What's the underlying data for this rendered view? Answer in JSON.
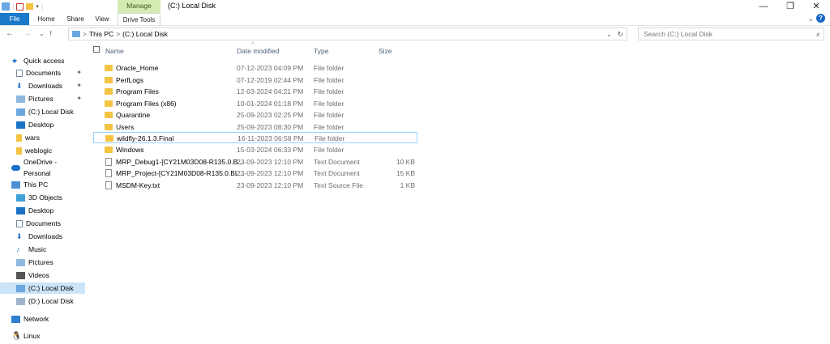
{
  "title_bar": {
    "manage_tab": "Manage",
    "window_title": "(C:) Local Disk",
    "minimize": "—",
    "maximize": "❐",
    "close": "✕"
  },
  "ribbon": {
    "tabs": [
      "File",
      "Home",
      "Share",
      "View",
      "Drive Tools"
    ],
    "help": "?"
  },
  "address": {
    "back": "←",
    "forward": "→",
    "recent": "⌄",
    "up": "↑",
    "crumbs": [
      "This PC",
      "(C:) Local Disk"
    ],
    "separator": ">",
    "dropdown": "⌄",
    "refresh": "↻",
    "search_placeholder": "Search (C:) Local Disk"
  },
  "sidebar": {
    "items": [
      {
        "label": "Quick access",
        "icon": "star-icon",
        "pinned": false
      },
      {
        "label": "Documents",
        "icon": "documents-icon",
        "pinned": true
      },
      {
        "label": "Downloads",
        "icon": "downloads-icon",
        "pinned": true
      },
      {
        "label": "Pictures",
        "icon": "pictures-icon",
        "pinned": true
      },
      {
        "label": "(C:) Local Disk",
        "icon": "drive-icon",
        "pinned": false
      },
      {
        "label": "Desktop",
        "icon": "desktop-icon",
        "pinned": false
      },
      {
        "label": "wars",
        "icon": "folder-icon",
        "pinned": false
      },
      {
        "label": "weblogic",
        "icon": "folder-icon",
        "pinned": false
      },
      {
        "label": "OneDrive - Personal",
        "icon": "cloud-icon",
        "pinned": false
      },
      {
        "label": "This PC",
        "icon": "computer-icon",
        "pinned": false
      },
      {
        "label": "3D Objects",
        "icon": "3d-objects-icon",
        "pinned": false
      },
      {
        "label": "Desktop",
        "icon": "desktop-icon",
        "pinned": false
      },
      {
        "label": "Documents",
        "icon": "documents-icon",
        "pinned": false
      },
      {
        "label": "Downloads",
        "icon": "downloads-icon",
        "pinned": false
      },
      {
        "label": "Music",
        "icon": "music-icon",
        "pinned": false
      },
      {
        "label": "Pictures",
        "icon": "pictures-icon",
        "pinned": false
      },
      {
        "label": "Videos",
        "icon": "videos-icon",
        "pinned": false
      },
      {
        "label": "(C:) Local Disk",
        "icon": "drive-icon",
        "pinned": false,
        "selected": true
      },
      {
        "label": "(D:) Local Disk",
        "icon": "drive-icon",
        "pinned": false
      },
      {
        "label": "Network",
        "icon": "network-icon",
        "pinned": false
      },
      {
        "label": "Linux",
        "icon": "linux-icon",
        "pinned": false
      }
    ],
    "pin_glyph": "📌"
  },
  "columns": {
    "name": "Name",
    "date": "Date modified",
    "type": "Type",
    "size": "Size",
    "sort_caret": "^"
  },
  "files": [
    {
      "name": "Oracle_Home",
      "date": "07-12-2023 04:09 PM",
      "type": "File folder",
      "size": "",
      "kind": "folder"
    },
    {
      "name": "PerfLogs",
      "date": "07-12-2019 02:44 PM",
      "type": "File folder",
      "size": "",
      "kind": "folder"
    },
    {
      "name": "Program Files",
      "date": "12-03-2024 04:21 PM",
      "type": "File folder",
      "size": "",
      "kind": "folder"
    },
    {
      "name": "Program Files (x86)",
      "date": "10-01-2024 01:18 PM",
      "type": "File folder",
      "size": "",
      "kind": "folder"
    },
    {
      "name": "Quarantine",
      "date": "25-09-2023 02:25 PM",
      "type": "File folder",
      "size": "",
      "kind": "folder"
    },
    {
      "name": "Users",
      "date": "25-09-2023 08:30 PM",
      "type": "File folder",
      "size": "",
      "kind": "folder"
    },
    {
      "name": "wildfly-26.1.3.Final",
      "date": "16-11-2023 06:58 PM",
      "type": "File folder",
      "size": "",
      "kind": "folder",
      "focused": true
    },
    {
      "name": "Windows",
      "date": "15-03-2024 06:33 PM",
      "type": "File folder",
      "size": "",
      "kind": "folder"
    },
    {
      "name": "MRP_Debug1-[CY21M03D08-R135.0.B...",
      "date": "23-09-2023 12:10 PM",
      "type": "Text Document",
      "size": "10 KB",
      "kind": "doc"
    },
    {
      "name": "MRP_Project-[CY21M03D08-R135.0.BL...",
      "date": "23-09-2023 12:10 PM",
      "type": "Text Document",
      "size": "15 KB",
      "kind": "doc"
    },
    {
      "name": "MSDM-Key.txt",
      "date": "23-09-2023 12:10 PM",
      "type": "Text Source File",
      "size": "1 KB",
      "kind": "doc"
    }
  ],
  "colors": {
    "file_tab": "#1979ca",
    "manage_tab": "#d3ebb3",
    "selection": "#cce4f7",
    "folder": "#f3c442"
  }
}
